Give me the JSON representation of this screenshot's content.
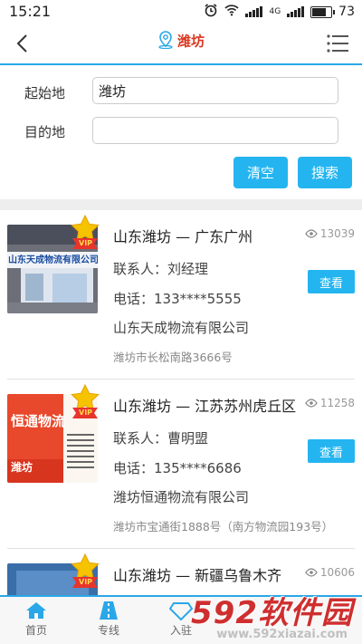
{
  "status_bar": {
    "time": "15:21",
    "network": "4G",
    "battery": "73",
    "battery_level": 0.73
  },
  "header": {
    "title": "潍坊"
  },
  "search": {
    "origin_label": "起始地",
    "origin_value": "潍坊",
    "destination_label": "目的地",
    "destination_value": "",
    "clear_label": "清空",
    "search_label": "搜索"
  },
  "listings": [
    {
      "route": "山东潍坊 — 广东广州",
      "views": "13039",
      "contact": "联系人：刘经理",
      "phone": "电话：133****5555",
      "company": "山东天成物流有限公司",
      "address": "潍坊市长松南路3666号",
      "view_label": "查看",
      "badge": "VIP",
      "thumb_caption": "山东天成物流有限公司办"
    },
    {
      "route": "山东潍坊 — 江苏苏州虎丘区",
      "views": "11258",
      "contact": "联系人：曹明盟",
      "phone": "电话：135****6686",
      "company": "潍坊恒通物流有限公司",
      "address": "潍坊市宝通街1888号（南方物流园193号）",
      "view_label": "查看",
      "badge": "VIP",
      "thumb_caption": "恒通物流",
      "thumb_city": "潍坊"
    },
    {
      "route": "山东潍坊 — 新疆乌鲁木齐",
      "views": "10606",
      "badge": "VIP"
    }
  ],
  "tabbar": {
    "items": [
      {
        "label": "首页"
      },
      {
        "label": "专线"
      },
      {
        "label": "入驻"
      }
    ]
  },
  "watermark": {
    "brand": "592软件园",
    "url": "www.592xiazai.com"
  },
  "colors": {
    "accent": "#24b5f0",
    "title_red": "#d9361f",
    "divider": "#eeeeee"
  }
}
